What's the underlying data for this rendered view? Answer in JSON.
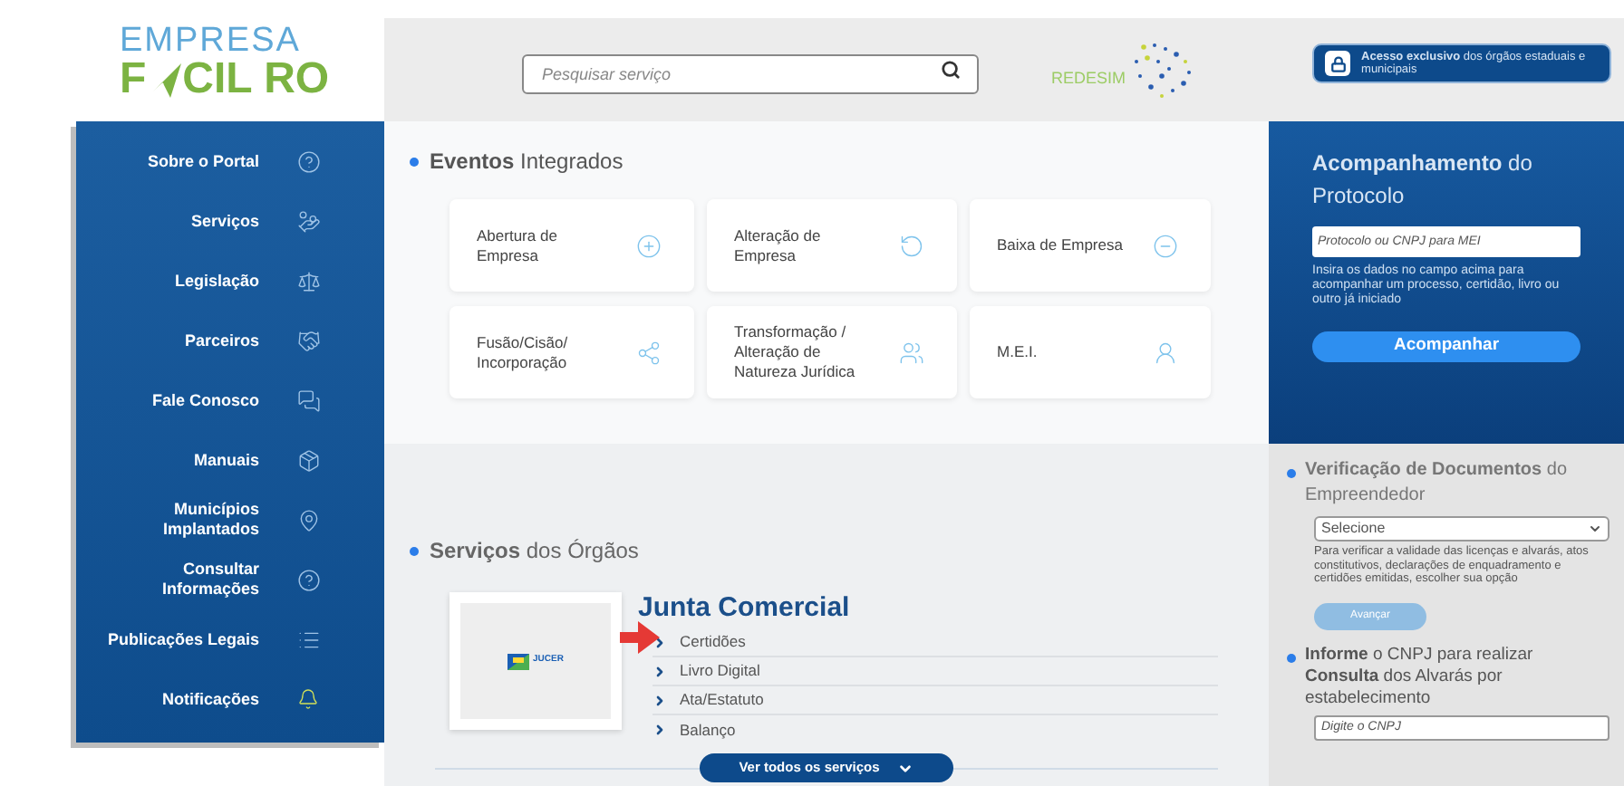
{
  "logo": {
    "top": "EMPRESA",
    "bottom_left": "F",
    "bottom_right": "CIL RO"
  },
  "search": {
    "placeholder": "Pesquisar serviço"
  },
  "redesim": {
    "label": "REDESIM"
  },
  "sidebar": {
    "items": [
      {
        "label": "Sobre o Portal"
      },
      {
        "label": "Serviços"
      },
      {
        "label": "Legislação"
      },
      {
        "label": "Parceiros"
      },
      {
        "label": "Fale Conosco"
      },
      {
        "label": "Manuais"
      },
      {
        "lines": [
          "Municípios",
          "Implantados"
        ]
      },
      {
        "lines": [
          "Consultar",
          "Informações"
        ]
      },
      {
        "label": "Publicações Legais"
      },
      {
        "label": "Notificações"
      }
    ]
  },
  "events": {
    "title": "**Eventos** Integrados",
    "cards": [
      {
        "label": "Abertura de Empresa"
      },
      {
        "label": "Alteração de Empresa"
      },
      {
        "label": "Baixa de Empresa"
      },
      {
        "label": "Fusão/Cisão/ Incorporação"
      },
      {
        "label": "Transformação / Alteração de Natureza Jurídica"
      },
      {
        "label": "M.E.I."
      }
    ]
  },
  "services": {
    "title": "**Serviços** dos Órgãos",
    "organ": {
      "logo_label": "JUCER",
      "name": "Junta Comercial",
      "links": [
        "Certidões",
        "Livro Digital",
        "Ata/Estatuto",
        "Balanço"
      ]
    },
    "more_button": "Ver todos os serviços"
  },
  "access_badge": "**Acesso exclusivo** dos órgãos estaduais e municipais",
  "protocol": {
    "title": "**Acompanhamento** do Protocolo",
    "placeholder": "Protocolo ou CNPJ para MEI",
    "help": "Insira os dados no campo acima para acompanhar um processo, certidão, livro ou outro já iniciado",
    "button": "Acompanhar"
  },
  "documents": {
    "title": "**Verificação de Documentos** do Empreendedor",
    "select": "Selecione",
    "help": "Para verificar a validade das licenças e alvarás, atos constitutivos, declarações de enquadramento e certidões emitidas, escolher sua opção",
    "button": {
      "label": "Avançar",
      "disabled": true
    }
  },
  "cnpj": {
    "title": "**Informe** o CNPJ para realizar **Consulta** dos Alvarás por estabelecimento",
    "placeholder": "Digite o CNPJ"
  }
}
